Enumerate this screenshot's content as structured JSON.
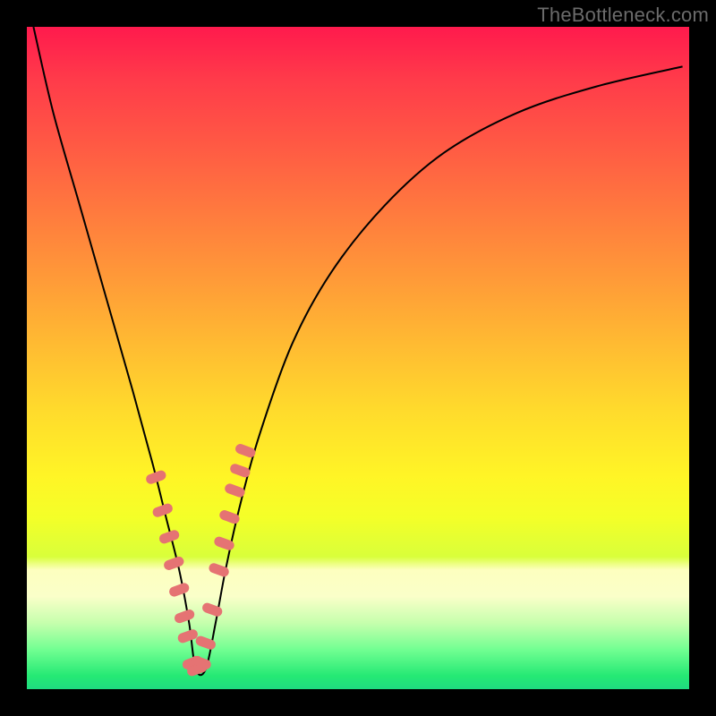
{
  "watermark": "TheBottleneck.com",
  "colors": {
    "frame": "#000000",
    "curve": "#000000",
    "marker": "#e57373",
    "gradient_top": "#ff1a4d",
    "gradient_bottom": "#1fdb80"
  },
  "chart_data": {
    "type": "line",
    "title": "",
    "xlabel": "",
    "ylabel": "",
    "xlim": [
      0,
      100
    ],
    "ylim": [
      0,
      100
    ],
    "grid": false,
    "legend": false,
    "note": "V-shaped bottleneck curve; axes unlabeled; x and y in 0–100 normalized plot units; lower y = better (green).",
    "series": [
      {
        "name": "bottleneck-curve",
        "x": [
          1,
          4,
          8,
          12,
          16,
          19,
          21,
          23,
          24.5,
          25.5,
          27,
          28.5,
          30,
          32,
          35,
          40,
          46,
          54,
          63,
          74,
          86,
          99
        ],
        "y": [
          100,
          87,
          73,
          59,
          45,
          34,
          26,
          18,
          10,
          3,
          3,
          10,
          18,
          27,
          38,
          52,
          63,
          73,
          81,
          87,
          91,
          94
        ]
      }
    ],
    "markers": {
      "name": "highlighted-points",
      "style": "salmon-pill",
      "x": [
        19.5,
        20.5,
        21.5,
        22.2,
        23.0,
        23.8,
        24.3,
        25.0,
        25.7,
        26.3,
        27.0,
        28.0,
        29.0,
        29.8,
        30.6,
        31.4,
        32.2,
        33.0
      ],
      "y": [
        32,
        27,
        23,
        19,
        15,
        11,
        8,
        4,
        3,
        4,
        7,
        12,
        18,
        22,
        26,
        30,
        33,
        36
      ]
    }
  }
}
